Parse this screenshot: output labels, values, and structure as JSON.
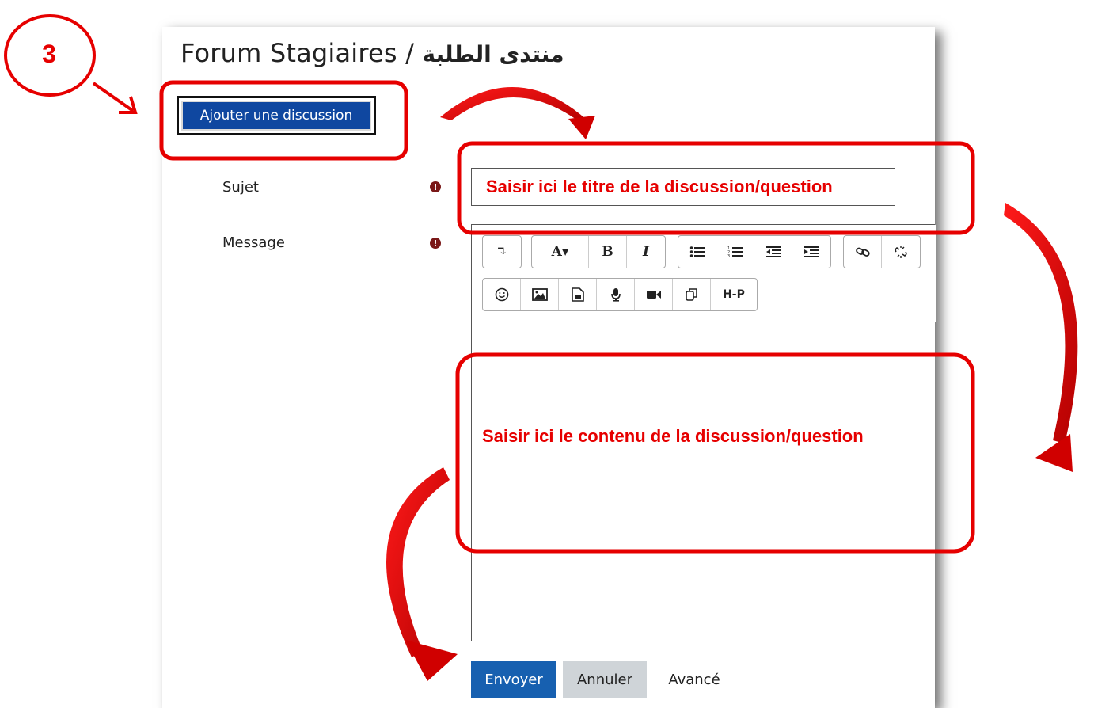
{
  "page": {
    "title_latin": "Forum Stagiaires / ",
    "title_arabic": "منتدى الطلبة"
  },
  "actions": {
    "add_discussion": "Ajouter une discussion"
  },
  "form": {
    "subject_label": "Sujet",
    "message_label": "Message",
    "required_symbol": "!"
  },
  "annotations": {
    "step_number": "3",
    "subject_hint": "Saisir ici le titre de la discussion/question",
    "content_hint": "Saisir ici le contenu de la discussion/question",
    "color": "#e60000"
  },
  "toolbar": {
    "row1": [
      [
        "↴"
      ],
      [
        "A▾",
        "B",
        "I"
      ],
      [
        "list-bullet-icon",
        "list-numbered-icon",
        "outdent-icon",
        "indent-icon"
      ],
      [
        "link-icon",
        "unlink-icon"
      ]
    ],
    "row2": [
      "emoji-icon",
      "image-icon",
      "media-icon",
      "microphone-icon",
      "video-icon",
      "copy-icon",
      "H-P"
    ]
  },
  "buttons": {
    "send": "Envoyer",
    "cancel": "Annuler",
    "advanced": "Avancé"
  },
  "colors": {
    "primary": "#1760b0",
    "add_button": "#0f47a0",
    "required": "#7a1818"
  }
}
